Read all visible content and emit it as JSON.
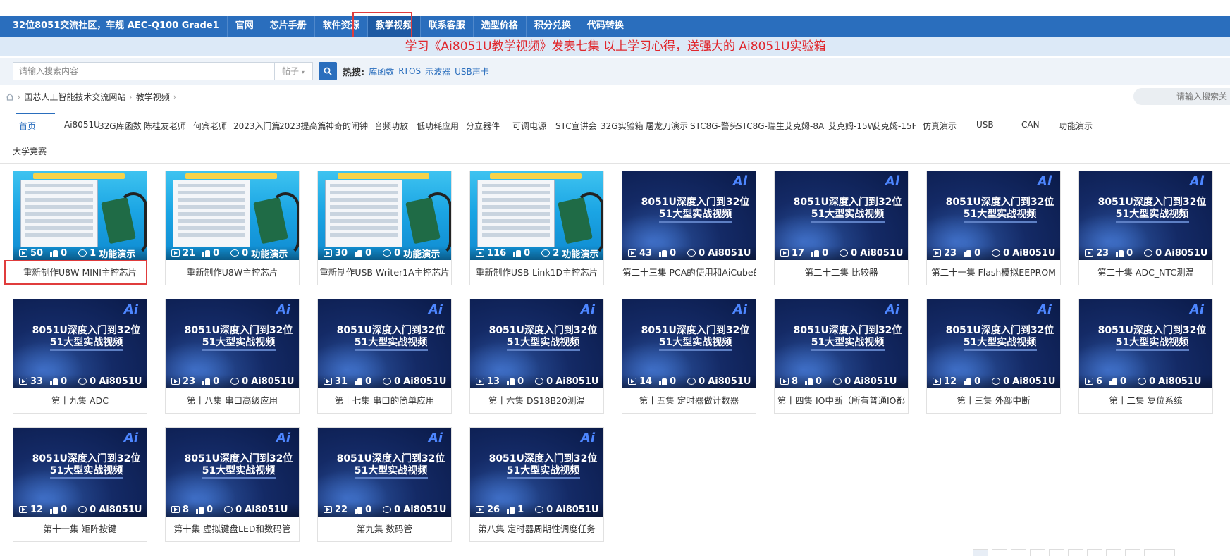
{
  "topnav": {
    "items": [
      {
        "label": "32位8051交流社区，车规 AEC-Q100 Grade1"
      },
      {
        "label": "官网"
      },
      {
        "label": "芯片手册"
      },
      {
        "label": "软件资源"
      },
      {
        "label": "教学视频"
      },
      {
        "label": "联系客服"
      },
      {
        "label": "选型价格"
      },
      {
        "label": "积分兑换"
      },
      {
        "label": "代码转换"
      }
    ],
    "active_index": 4
  },
  "announcement": "学习《Ai8051U教学视频》发表七集 以上学习心得，送强大的 Ai8051U实验箱",
  "search": {
    "placeholder": "请输入搜索内容",
    "type": "帖子",
    "hot_label": "热搜:",
    "hot_links": [
      "库函数",
      "RTOS",
      "示波器",
      "USB声卡"
    ]
  },
  "breadcrumb": [
    "国芯人工智能技术交流网站",
    "教学视频"
  ],
  "right_search_placeholder": "请输入搜索关",
  "category_tabs": [
    "首页",
    "Ai8051U",
    "32G库函数",
    "陈桂友老师",
    "何宾老师",
    "2023入门篇",
    "2023提高篇",
    "神奇的闹钟",
    "音频功放",
    "低功耗应用",
    "分立器件",
    "可调电源",
    "STC宣讲会",
    "32G实验箱",
    "屠龙刀演示",
    "STC8G-警头",
    "STC8G-瑞生",
    "艾克姆-8A",
    "艾克姆-15W",
    "艾克姆-15F",
    "仿真演示",
    "USB",
    "CAN",
    "功能演示",
    "大学竞赛"
  ],
  "thumbnail_text": {
    "line1": "8051U深度入门到32位",
    "line2": "51大型实战视频",
    "logo": "Ai"
  },
  "videos": [
    {
      "title": "重新制作U8W-MINI主控芯片",
      "views": "50",
      "likes": "0",
      "comments": "1",
      "category": "功能演示",
      "thumb": "screen"
    },
    {
      "title": "重新制作U8W主控芯片",
      "views": "21",
      "likes": "0",
      "comments": "0",
      "category": "功能演示",
      "thumb": "screen"
    },
    {
      "title": "重新制作USB-Writer1A主控芯片",
      "views": "30",
      "likes": "0",
      "comments": "0",
      "category": "功能演示",
      "thumb": "screen"
    },
    {
      "title": "重新制作USB-Link1D主控芯片",
      "views": "116",
      "likes": "0",
      "comments": "2",
      "category": "功能演示",
      "thumb": "screen"
    },
    {
      "title": "第二十三集 PCA的使用和AiCube的",
      "views": "43",
      "likes": "0",
      "comments": "0",
      "category": "Ai8051U",
      "thumb": "space"
    },
    {
      "title": "第二十二集 比较器",
      "views": "17",
      "likes": "0",
      "comments": "0",
      "category": "Ai8051U",
      "thumb": "space"
    },
    {
      "title": "第二十一集 Flash模拟EEPROM",
      "views": "23",
      "likes": "0",
      "comments": "0",
      "category": "Ai8051U",
      "thumb": "space"
    },
    {
      "title": "第二十集 ADC_NTC测温",
      "views": "23",
      "likes": "0",
      "comments": "0",
      "category": "Ai8051U",
      "thumb": "space"
    },
    {
      "title": "第十九集 ADC",
      "views": "33",
      "likes": "0",
      "comments": "0",
      "category": "Ai8051U",
      "thumb": "space"
    },
    {
      "title": "第十八集 串口高级应用",
      "views": "23",
      "likes": "0",
      "comments": "0",
      "category": "Ai8051U",
      "thumb": "space"
    },
    {
      "title": "第十七集 串口的简单应用",
      "views": "31",
      "likes": "0",
      "comments": "0",
      "category": "Ai8051U",
      "thumb": "space"
    },
    {
      "title": "第十六集 DS18B20测温",
      "views": "13",
      "likes": "0",
      "comments": "0",
      "category": "Ai8051U",
      "thumb": "space"
    },
    {
      "title": "第十五集 定时器做计数器",
      "views": "14",
      "likes": "0",
      "comments": "0",
      "category": "Ai8051U",
      "thumb": "space"
    },
    {
      "title": "第十四集 IO中断（所有普通IO都",
      "views": "8",
      "likes": "0",
      "comments": "0",
      "category": "Ai8051U",
      "thumb": "space"
    },
    {
      "title": "第十三集 外部中断",
      "views": "12",
      "likes": "0",
      "comments": "0",
      "category": "Ai8051U",
      "thumb": "space"
    },
    {
      "title": "第十二集 复位系统",
      "views": "6",
      "likes": "0",
      "comments": "0",
      "category": "Ai8051U",
      "thumb": "space"
    },
    {
      "title": "第十一集 矩阵按键",
      "views": "12",
      "likes": "0",
      "comments": "0",
      "category": "Ai8051U",
      "thumb": "space"
    },
    {
      "title": "第十集 虚拟键盘LED和数码管",
      "views": "8",
      "likes": "0",
      "comments": "0",
      "category": "Ai8051U",
      "thumb": "space"
    },
    {
      "title": "第九集 数码管",
      "views": "22",
      "likes": "0",
      "comments": "0",
      "category": "Ai8051U",
      "thumb": "space"
    },
    {
      "title": "第八集 定时器周期性调度任务",
      "views": "26",
      "likes": "1",
      "comments": "0",
      "category": "Ai8051U",
      "thumb": "space"
    }
  ],
  "colors": {
    "nav_bg": "#2a6ebd",
    "announce_text": "#e0262c",
    "highlight": "#e03c3c"
  }
}
